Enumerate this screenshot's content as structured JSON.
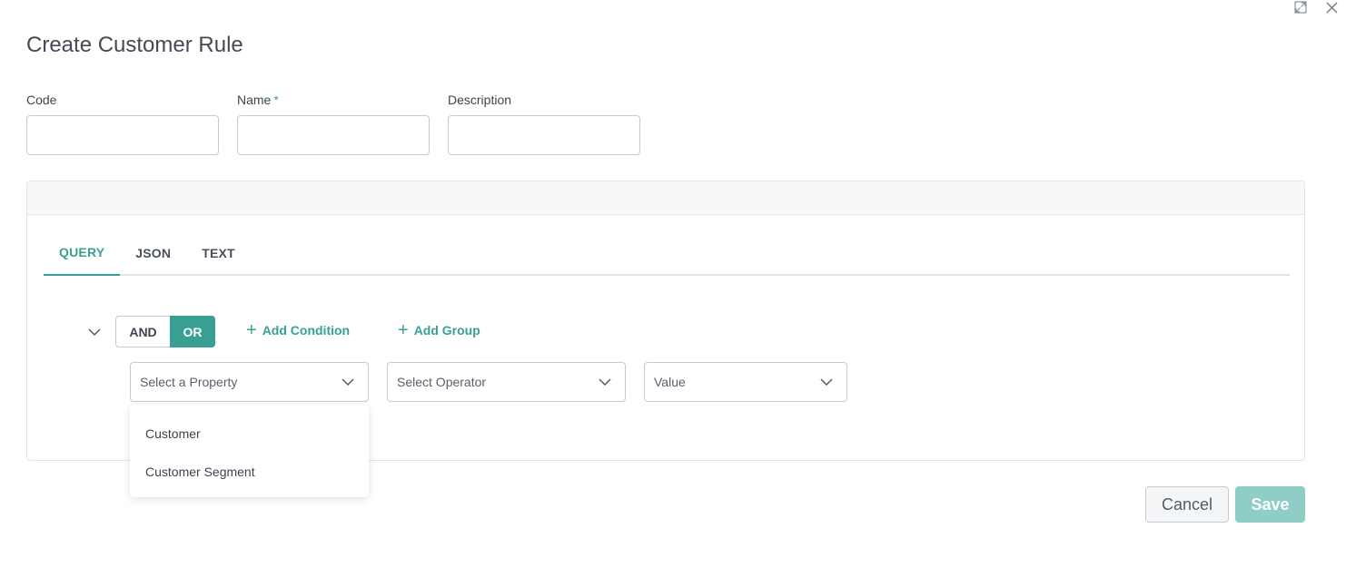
{
  "window": {
    "icons": [
      "expand-icon",
      "close-icon"
    ]
  },
  "title": "Create Customer Rule",
  "form": {
    "code": {
      "label": "Code",
      "value": "",
      "placeholder": ""
    },
    "name": {
      "label": "Name",
      "required_mark": "*",
      "value": "",
      "placeholder": ""
    },
    "description": {
      "label": "Description",
      "value": "",
      "placeholder": ""
    }
  },
  "query_builder": {
    "tabs": [
      {
        "label": "QUERY",
        "active": true
      },
      {
        "label": "JSON",
        "active": false
      },
      {
        "label": "TEXT",
        "active": false
      }
    ],
    "logic": {
      "and_label": "AND",
      "or_label": "OR",
      "selected": "OR"
    },
    "add_condition_label": "Add Condition",
    "add_group_label": "Add Group",
    "condition": {
      "property_placeholder": "Select a Property",
      "operator_placeholder": "Select Operator",
      "value_placeholder": "Value"
    },
    "property_options": [
      "Customer",
      "Customer Segment"
    ]
  },
  "actions": {
    "cancel_label": "Cancel",
    "save_label": "Save"
  },
  "colors": {
    "accent": "#3a9f93",
    "save_disabled": "#8fcec6"
  }
}
